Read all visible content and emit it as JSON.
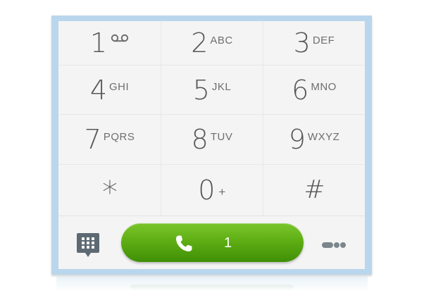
{
  "keypad": {
    "keys": [
      {
        "digit": "1",
        "letters": "",
        "icon": "voicemail-icon"
      },
      {
        "digit": "2",
        "letters": "ABC"
      },
      {
        "digit": "3",
        "letters": "DEF"
      },
      {
        "digit": "4",
        "letters": "GHI"
      },
      {
        "digit": "5",
        "letters": "JKL"
      },
      {
        "digit": "6",
        "letters": "MNO"
      },
      {
        "digit": "7",
        "letters": "PQRS"
      },
      {
        "digit": "8",
        "letters": "TUV"
      },
      {
        "digit": "9",
        "letters": "WXYZ"
      },
      {
        "digit": "*",
        "letters": ""
      },
      {
        "digit": "0",
        "letters": "+"
      },
      {
        "digit": "#",
        "letters": ""
      }
    ]
  },
  "bottom_bar": {
    "dialpad_icon": "dialpad-grid-icon",
    "call_button": {
      "icon": "phone-handset-icon",
      "label": "1"
    },
    "more_icon": "more-options-icon"
  },
  "colors": {
    "frame": "#bad6ec",
    "call_green": "#5fae14",
    "keypad_bg": "#f4f4f4",
    "digit_text": "#585858"
  }
}
